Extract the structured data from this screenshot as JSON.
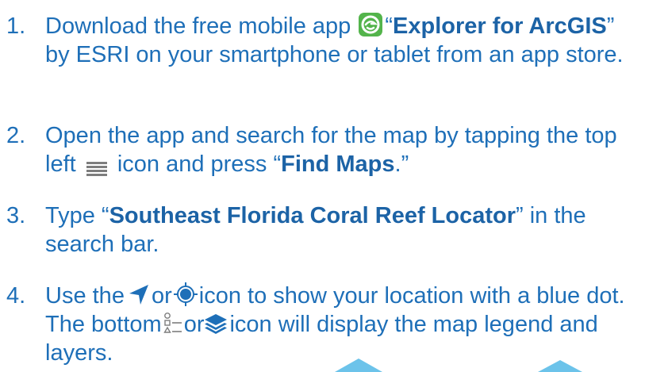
{
  "colors": {
    "text": "#1e6fb8",
    "bold_text": "#1c63a6",
    "app_icon_green": "#53b44b",
    "icon_gray": "#7d7d7d",
    "icon_blue": "#1e6fb8",
    "deco_light_blue": "#6cc3ea"
  },
  "steps": [
    {
      "number": "1.",
      "text_before_icon": "Download the free mobile app",
      "icon": "explorer-for-arcgis-app-icon",
      "quote_open": "“",
      "bold": "Explorer for ArcGIS",
      "text_after": "” by ESRI on your smartphone or tablet from an app store."
    },
    {
      "number": "2.",
      "text_before_icon": "Open the app and search for the map by tapping the top left",
      "icon": "hamburger-menu-icon",
      "text_after_icon": "icon and press “",
      "bold": "Find Maps",
      "text_after": ".”"
    },
    {
      "number": "3.",
      "text_before": "Type “",
      "bold": "Southeast Florida Coral Reef Locator",
      "text_after": "” in the search bar."
    },
    {
      "number": "4.",
      "text_use": "Use the",
      "icon_1": "navigation-arrow-icon",
      "text_or_1": "or",
      "icon_2": "location-target-icon",
      "text_middle": "icon to show your location with a blue dot. The bottom",
      "icon_3": "legend-list-icon",
      "text_or_2": "or",
      "icon_4": "layers-icon",
      "text_end": "icon will display the map legend and layers."
    }
  ]
}
